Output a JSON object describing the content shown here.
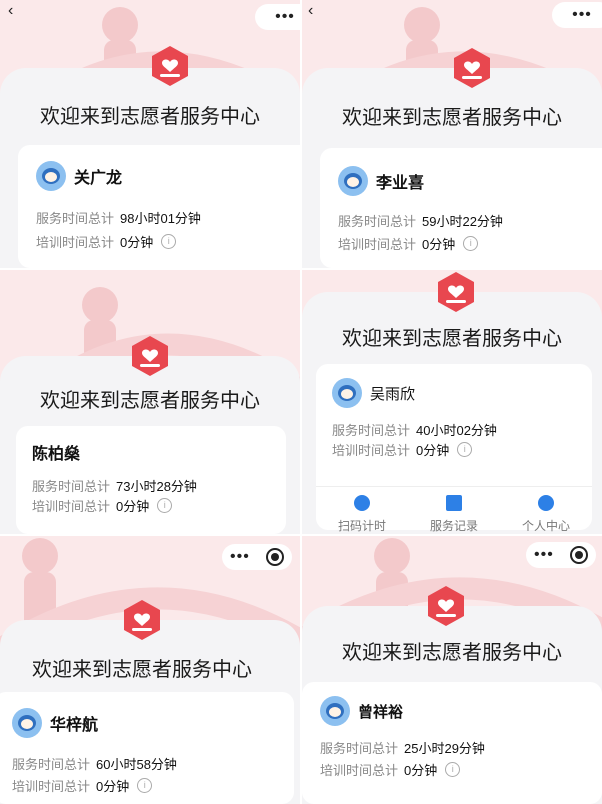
{
  "welcome": "欢迎来到志愿者服务中心",
  "labels": {
    "service_total": "服务时间总计",
    "training_total": "培训时间总计"
  },
  "info_glyph": "i",
  "back_glyph": "‹",
  "menu_glyph": "•••",
  "panels": [
    {
      "name": "关广龙",
      "service": "98小时01分钟",
      "training": "0分钟"
    },
    {
      "name": "李业喜",
      "service": "59小时22分钟",
      "training": "0分钟"
    },
    {
      "name": "陈柏燊",
      "service": "73小时28分钟",
      "training": "0分钟"
    },
    {
      "name": "吴雨欣",
      "service": "40小时02分钟",
      "training": "0分钟"
    },
    {
      "name": "华梓航",
      "service": "60小时58分钟",
      "training": "0分钟"
    },
    {
      "name": "曾祥裕",
      "service": "25小时29分钟",
      "training": "0分钟"
    }
  ],
  "tabs": [
    {
      "label": "扫码计时",
      "icon": "clock-icon"
    },
    {
      "label": "服务记录",
      "icon": "record-icon"
    },
    {
      "label": "个人中心",
      "icon": "person-icon"
    }
  ],
  "colors": {
    "logo": "#e8474f",
    "accent": "#2d80e6",
    "banner": "#fbe9ea"
  }
}
